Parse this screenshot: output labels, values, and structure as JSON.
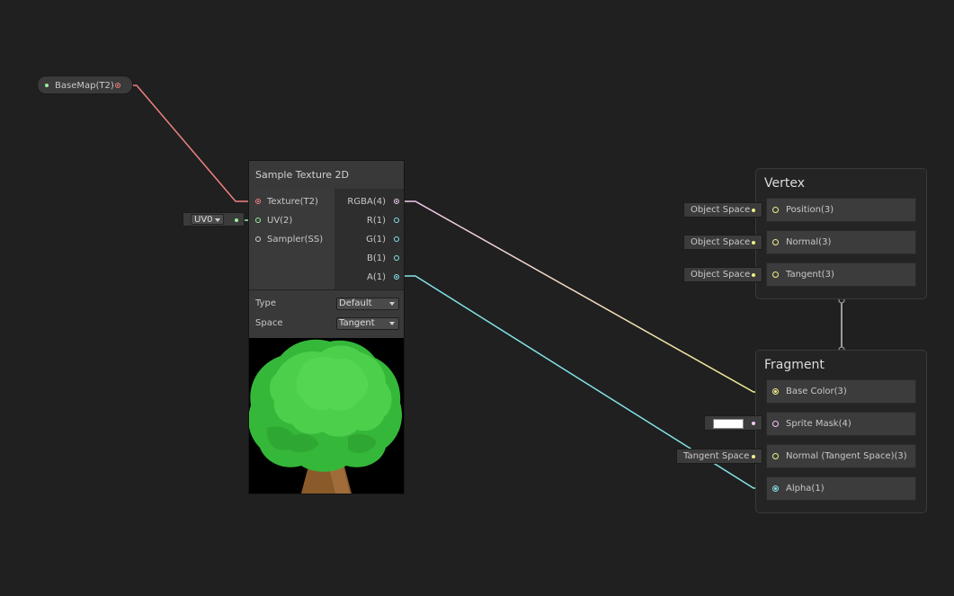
{
  "property": {
    "label": "BaseMap(T2)"
  },
  "sample_node": {
    "title": "Sample Texture 2D",
    "inputs": [
      "Texture(T2)",
      "UV(2)",
      "Sampler(SS)"
    ],
    "outputs": [
      "RGBA(4)",
      "R(1)",
      "G(1)",
      "B(1)",
      "A(1)"
    ],
    "type_label": "Type",
    "type_value": "Default",
    "space_label": "Space",
    "space_value": "Tangent",
    "uv_channel": "UV0"
  },
  "vertex": {
    "title": "Vertex",
    "blocks": [
      {
        "label": "Position(3)",
        "space": "Object Space"
      },
      {
        "label": "Normal(3)",
        "space": "Object Space"
      },
      {
        "label": "Tangent(3)",
        "space": "Object Space"
      }
    ]
  },
  "fragment": {
    "title": "Fragment",
    "blocks": [
      {
        "label": "Base Color(3)"
      },
      {
        "label": "Sprite Mask(4)"
      },
      {
        "label": "Normal (Tangent Space)(3)",
        "space": "Tangent Space"
      },
      {
        "label": "Alpha(1)"
      }
    ]
  },
  "colors": {
    "background": "#202020",
    "texture_wire": "#f08080",
    "vector4_wire": "#f0c8f0",
    "vector3_wire": "#f0f08c",
    "float_wire": "#84e4e8",
    "vector2_wire": "#9cf09c"
  }
}
